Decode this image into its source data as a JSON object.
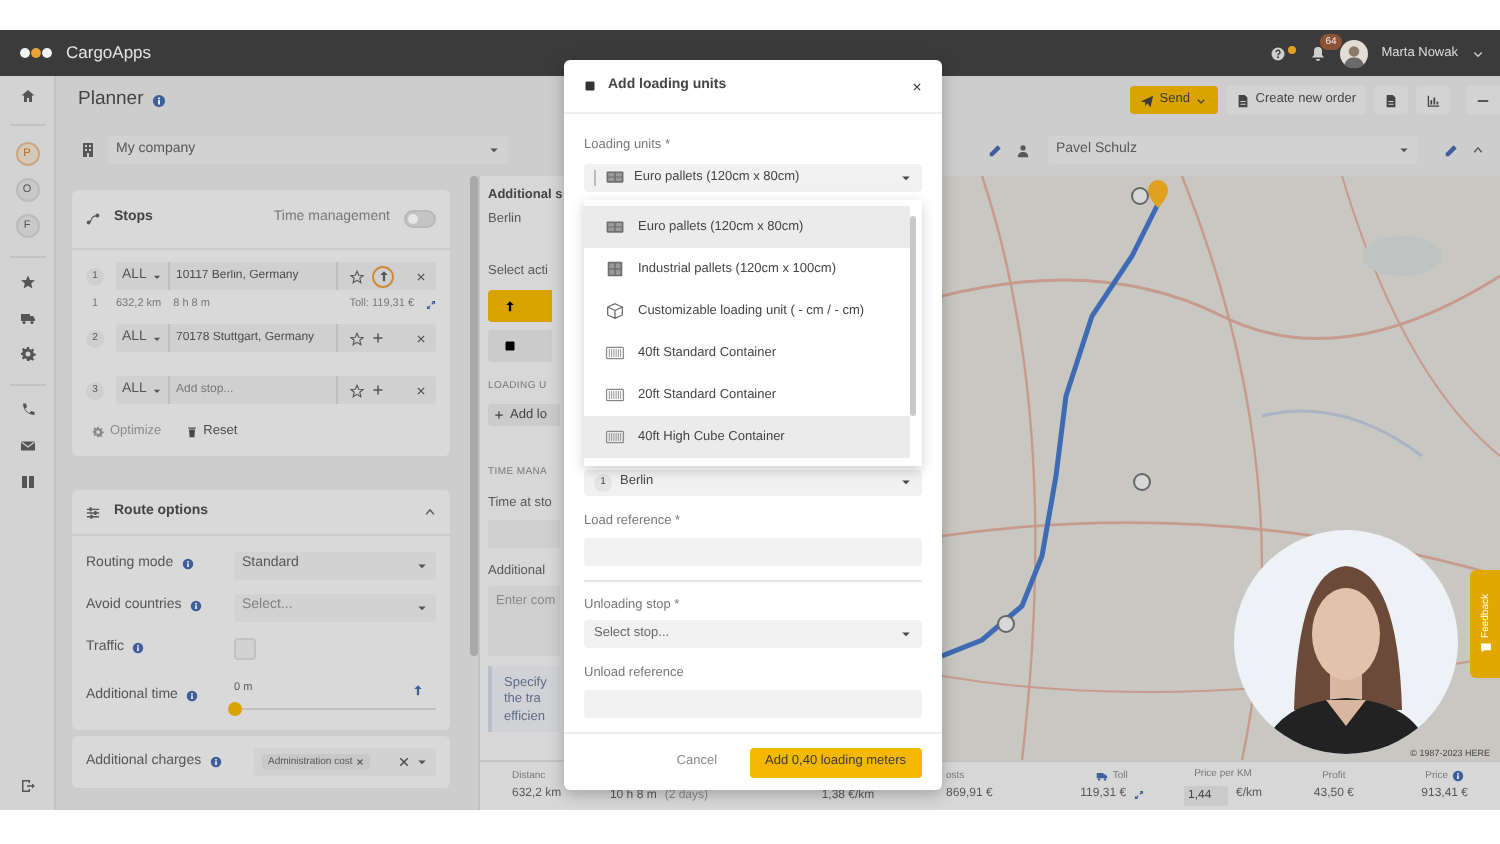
{
  "header": {
    "brand": "CargoApps",
    "notifications": "64",
    "user": "Marta Nowak"
  },
  "rail_letters": [
    {
      "letter": "P",
      "selected": true
    },
    {
      "letter": "O",
      "selected": false
    },
    {
      "letter": "F",
      "selected": false
    }
  ],
  "planner": {
    "title": "Planner",
    "company": "My company"
  },
  "toolbar": {
    "send": "Send",
    "create": "Create new order"
  },
  "driver": "Pavel Schulz",
  "stops": {
    "title": "Stops",
    "time_management": {
      "label": "Time management",
      "on": false
    },
    "rows": [
      {
        "number": "1",
        "type": "ALL",
        "address": "10117 Berlin, Germany",
        "kind": "move-up",
        "leg": {
          "number": "1",
          "distance": "632,2 km",
          "duration": "8 h 8 m",
          "toll": "Toll: 119,31 €"
        }
      },
      {
        "number": "2",
        "type": "ALL",
        "address": "70178 Stuttgart, Germany",
        "kind": "add"
      },
      {
        "number": "3",
        "type": "ALL",
        "placeholder": "Add stop...",
        "kind": "add"
      }
    ],
    "actions": [
      {
        "kind": "optimize",
        "label": "Optimize",
        "disabled": true
      },
      {
        "kind": "reset",
        "label": "Reset",
        "disabled": false
      }
    ]
  },
  "route_options": {
    "title": "Route options",
    "expanded": true,
    "fields": [
      {
        "kind": "select",
        "label": "Routing mode",
        "value": "Standard"
      },
      {
        "kind": "select",
        "label": "Avoid countries",
        "placeholder": "Select..."
      },
      {
        "kind": "checkbox",
        "label": "Traffic",
        "checked": false
      },
      {
        "kind": "slider",
        "label": "Additional time",
        "reading": "0 m",
        "level": 0
      }
    ]
  },
  "charges": {
    "label": "Additional charges",
    "tags": [
      "Administration cost"
    ]
  },
  "middle": {
    "title": "Additional s",
    "subtitle": "Berlin",
    "select_label": "Select acti",
    "section_loading": "LOADING U",
    "add_button": "Add lo",
    "section_time": "TIME MANA",
    "time_label": "Time at sto",
    "comment_label": "Additional",
    "comment_placeholder": "Enter com",
    "hint_lines": [
      "Specify",
      "the tra",
      "efficien"
    ]
  },
  "map": {
    "copyright": "© 1987-2023 HERE"
  },
  "feedback": "Feedback",
  "summary": [
    {
      "kind": "plain",
      "label": "Distanc",
      "value": "632,2 km"
    },
    {
      "kind": "plain",
      "value": "10 h 8 m",
      "note": "(2 days)"
    },
    {
      "kind": "plain",
      "value": "1,38 €/km"
    },
    {
      "kind": "plain",
      "label": "osts",
      "value": "869,91 €"
    },
    {
      "kind": "toll",
      "label": "Toll",
      "value": "119,31 €"
    },
    {
      "kind": "input",
      "label": "Price per KM",
      "value": "1,44",
      "unit": "€/km"
    },
    {
      "kind": "plain",
      "label": "Profit",
      "value": "43,50 €"
    },
    {
      "kind": "info",
      "label": "Price",
      "value": "913,41 €"
    }
  ],
  "modal": {
    "title": "Add loading units",
    "units": {
      "label": "Loading units *",
      "value": {
        "kind": "pallet",
        "label": "Euro pallets (120cm x 80cm)"
      },
      "options": [
        {
          "kind": "pallet",
          "label": "Euro pallets (120cm x 80cm)",
          "highlighted": true
        },
        {
          "kind": "pallet-square",
          "label": "Industrial pallets (120cm x 100cm)",
          "highlighted": false
        },
        {
          "kind": "cube",
          "label": "Customizable loading unit ( - cm / - cm)",
          "highlighted": false
        },
        {
          "kind": "container",
          "label": "40ft Standard Container",
          "highlighted": false
        },
        {
          "kind": "container",
          "label": "20ft Standard Container",
          "highlighted": false
        },
        {
          "kind": "container",
          "label": "40ft High Cube Container",
          "highlighted": true
        }
      ]
    },
    "loading_stop": {
      "number": "1",
      "value": "Berlin"
    },
    "load_reference": {
      "label": "Load reference *"
    },
    "unloading_stop": {
      "label": "Unloading stop *",
      "placeholder": "Select stop..."
    },
    "unload_reference": {
      "label": "Unload reference"
    },
    "cancel": "Cancel",
    "submit": "Add 0,40 loading meters"
  }
}
